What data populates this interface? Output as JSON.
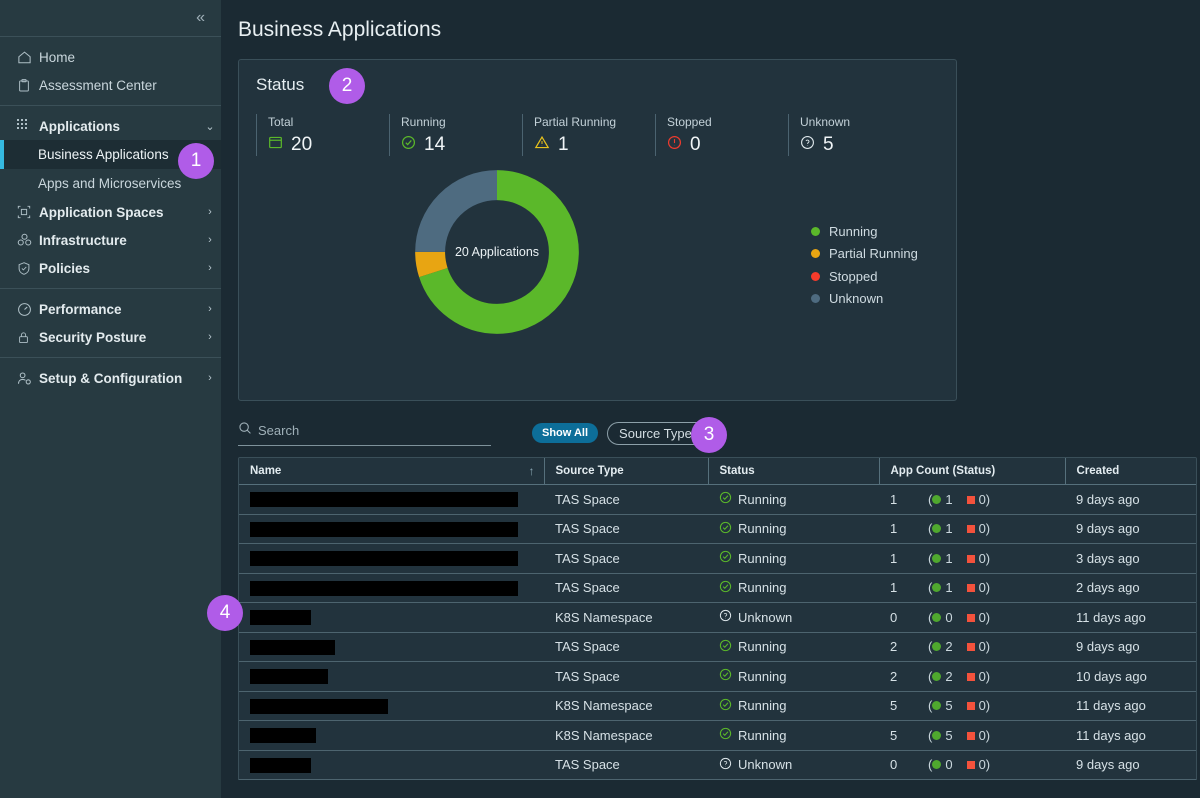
{
  "sidebar": {
    "collapse_icon": "«",
    "groups": [
      {
        "items": [
          {
            "label": "Home",
            "icon": "home-icon",
            "bold": false,
            "chevron": ""
          },
          {
            "label": "Assessment Center",
            "icon": "clipboard-icon",
            "bold": false,
            "chevron": ""
          }
        ]
      },
      {
        "items": [
          {
            "label": "Applications",
            "icon": "grid-dots-icon",
            "bold": true,
            "chevron": "⌄"
          }
        ],
        "subitems": [
          {
            "label": "Business Applications",
            "active": true
          },
          {
            "label": "Apps and Microservices",
            "active": false
          }
        ],
        "items2": [
          {
            "label": "Application Spaces",
            "icon": "app-spaces-icon",
            "bold": true,
            "chevron": "›"
          },
          {
            "label": "Infrastructure",
            "icon": "infrastructure-icon",
            "bold": true,
            "chevron": "›"
          },
          {
            "label": "Policies",
            "icon": "shield-icon",
            "bold": true,
            "chevron": "›"
          }
        ]
      },
      {
        "items": [
          {
            "label": "Performance",
            "icon": "speedometer-icon",
            "bold": true,
            "chevron": "›"
          },
          {
            "label": "Security Posture",
            "icon": "lock-icon",
            "bold": true,
            "chevron": "›"
          }
        ]
      },
      {
        "items": [
          {
            "label": "Setup & Configuration",
            "icon": "person-gear-icon",
            "bold": true,
            "chevron": "›"
          }
        ]
      }
    ]
  },
  "header": {
    "title": "Business Applications"
  },
  "status_card": {
    "title": "Status",
    "kpis": [
      {
        "label": "Total",
        "value": "20",
        "icon": "window-icon",
        "color": "#5bb82a"
      },
      {
        "label": "Running",
        "value": "14",
        "icon": "check-circle-icon",
        "color": "#5bb82a"
      },
      {
        "label": "Partial Running",
        "value": "1",
        "icon": "warning-triangle-icon",
        "color": "#e8c21c"
      },
      {
        "label": "Stopped",
        "value": "0",
        "icon": "error-circle-icon",
        "color": "#ef3b2e"
      },
      {
        "label": "Unknown",
        "value": "5",
        "icon": "question-circle-icon",
        "color": "#e8eff2"
      }
    ],
    "center_label": "20 Applications"
  },
  "chart_data": {
    "type": "pie",
    "title": "Status",
    "center_label": "20 Applications",
    "total": 20,
    "categories": [
      "Running",
      "Partial Running",
      "Stopped",
      "Unknown"
    ],
    "values": [
      14,
      1,
      0,
      5
    ],
    "colors": [
      "#5bb82a",
      "#e8a512",
      "#f63b2b",
      "#4e6b80"
    ],
    "legend": [
      "Running",
      "Partial Running",
      "Stopped",
      "Unknown"
    ],
    "legend_position": "right",
    "donut": true,
    "grid": false
  },
  "toolbar": {
    "search_placeholder": "Search",
    "search_value": "",
    "search_icon": "search-icon",
    "show_all_label": "Show All",
    "source_type_label": "Source Type",
    "chevron_icon": "⌄"
  },
  "table": {
    "columns": [
      "Name",
      "Source Type",
      "Status",
      "App Count (Status)",
      "Created"
    ],
    "sort_column": "Name",
    "sort_arrow": "↑",
    "rows": [
      {
        "name_width": 268,
        "source_type": "TAS Space",
        "status": "Running",
        "status_icon": "check-circle-icon",
        "app_count": "1",
        "running": "1",
        "stopped": "0",
        "created": "9 days ago"
      },
      {
        "name_width": 268,
        "source_type": "TAS Space",
        "status": "Running",
        "status_icon": "check-circle-icon",
        "app_count": "1",
        "running": "1",
        "stopped": "0",
        "created": "9 days ago"
      },
      {
        "name_width": 268,
        "source_type": "TAS Space",
        "status": "Running",
        "status_icon": "check-circle-icon",
        "app_count": "1",
        "running": "1",
        "stopped": "0",
        "created": "3 days ago"
      },
      {
        "name_width": 268,
        "source_type": "TAS Space",
        "status": "Running",
        "status_icon": "check-circle-icon",
        "app_count": "1",
        "running": "1",
        "stopped": "0",
        "created": "2 days ago"
      },
      {
        "name_width": 61,
        "source_type": "K8S Namespace",
        "status": "Unknown",
        "status_icon": "question-circle-icon",
        "app_count": "0",
        "running": "0",
        "stopped": "0",
        "created": "11 days ago"
      },
      {
        "name_width": 85,
        "source_type": "TAS Space",
        "status": "Running",
        "status_icon": "check-circle-icon",
        "app_count": "2",
        "running": "2",
        "stopped": "0",
        "created": "9 days ago"
      },
      {
        "name_width": 78,
        "source_type": "TAS Space",
        "status": "Running",
        "status_icon": "check-circle-icon",
        "app_count": "2",
        "running": "2",
        "stopped": "0",
        "created": "10 days ago"
      },
      {
        "name_width": 138,
        "source_type": "K8S Namespace",
        "status": "Running",
        "status_icon": "check-circle-icon",
        "app_count": "5",
        "running": "5",
        "stopped": "0",
        "created": "11 days ago"
      },
      {
        "name_width": 66,
        "source_type": "K8S Namespace",
        "status": "Running",
        "status_icon": "check-circle-icon",
        "app_count": "5",
        "running": "5",
        "stopped": "0",
        "created": "11 days ago"
      },
      {
        "name_width": 61,
        "source_type": "TAS Space",
        "status": "Unknown",
        "status_icon": "question-circle-icon",
        "app_count": "0",
        "running": "0",
        "stopped": "0",
        "created": "9 days ago"
      }
    ]
  },
  "badges": [
    {
      "id": "badge1",
      "label": "1"
    },
    {
      "id": "badge2",
      "label": "2"
    },
    {
      "id": "badge3",
      "label": "3"
    },
    {
      "id": "badge4",
      "label": "4"
    }
  ],
  "colors": {
    "accent_purple": "#b05ce8",
    "active_blue": "#35b9e0",
    "button_blue": "#0d6e99",
    "green": "#5bb82a",
    "orange": "#e8a512",
    "red": "#f63b2b",
    "slate": "#4e6b80",
    "page_bg": "#1b2a33",
    "card_bg": "#22333d",
    "sidebar_bg": "#273a41"
  }
}
